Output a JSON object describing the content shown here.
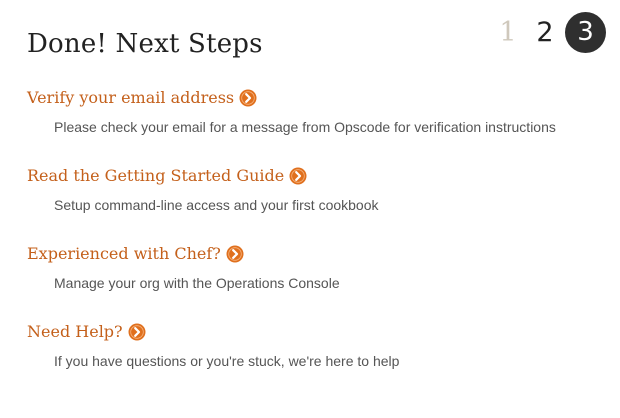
{
  "header": {
    "title": "Done! Next Steps",
    "steps": [
      "1",
      "2",
      "3"
    ],
    "active_step": "3"
  },
  "items": [
    {
      "label": "Verify your email address",
      "description": "Please check your email for a message from Opscode for verification instructions"
    },
    {
      "label": "Read the Getting Started Guide",
      "description": "Setup command-line access and your first cookbook"
    },
    {
      "label": "Experienced with Chef?",
      "description": "Manage your org with the Operations Console"
    },
    {
      "label": "Need Help?",
      "description": "If you have questions or you're stuck, we're here to help"
    }
  ],
  "colors": {
    "link": "#c4601b",
    "arrow_icon": "#e0701e",
    "active_step_bg": "#2f2f2f",
    "inactive_step": "#cfc8bc",
    "title": "#222222",
    "description": "#555555"
  },
  "icons": {
    "link_arrow": "chevron-right-circle-icon"
  }
}
